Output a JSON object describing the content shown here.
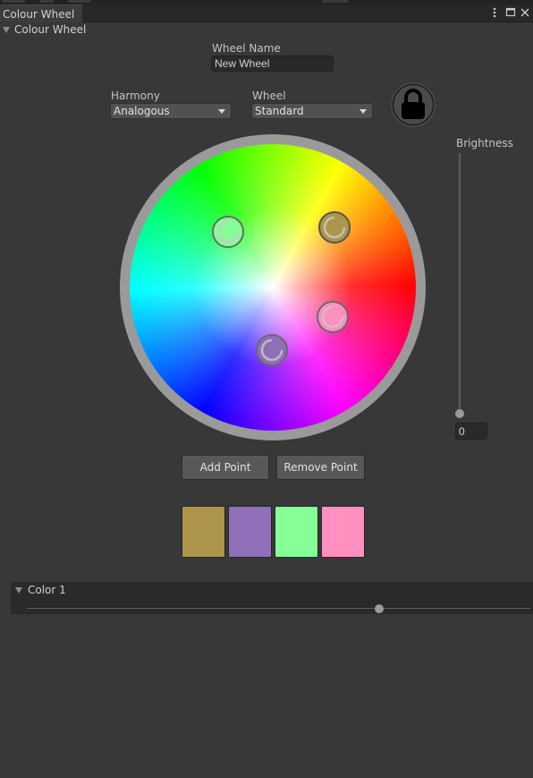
{
  "window": {
    "tab_title": "Colour Wheel",
    "menu_icon": "kebab-menu-icon",
    "maximize_icon": "maximize-icon",
    "close_icon": "close-icon"
  },
  "foldout": {
    "title": "Colour Wheel",
    "icon": "foldout-arrow-icon"
  },
  "wheel_name": {
    "label": "Wheel Name",
    "value": "New Wheel"
  },
  "harmony": {
    "label": "Harmony",
    "selected": "Analogous"
  },
  "wheel_type": {
    "label": "Wheel",
    "selected": "Standard"
  },
  "lock": {
    "icon": "lock-icon",
    "locked": true
  },
  "brightness": {
    "label": "Brightness",
    "value": "0",
    "level": 0
  },
  "color_points": [
    {
      "color": "#ad954c",
      "selected": true
    },
    {
      "color": "#8f6fb8"
    },
    {
      "color": "#86ff96"
    },
    {
      "color": "#ff90c0"
    }
  ],
  "buttons": {
    "add": "Add Point",
    "remove": "Remove Point"
  },
  "swatches": [
    "#ad954c",
    "#8f6fb8",
    "#86ff96",
    "#ff90c0"
  ],
  "color_section": {
    "title": "Color 1",
    "slider_value": 0.7
  }
}
